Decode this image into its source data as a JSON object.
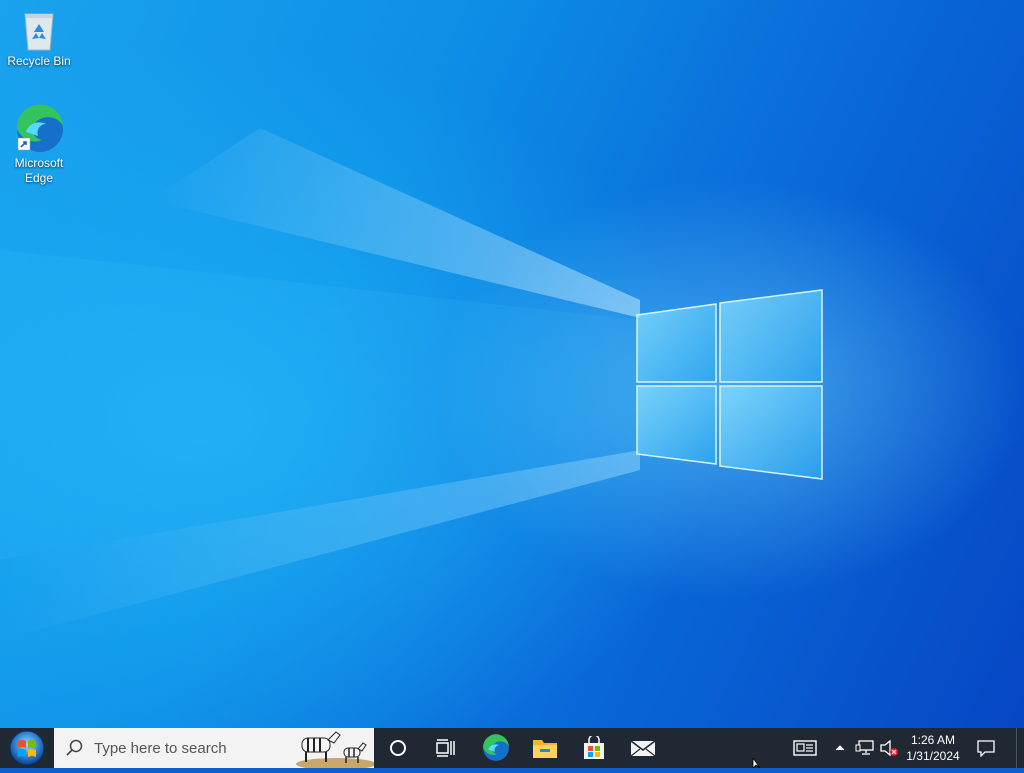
{
  "desktop": {
    "icons": [
      {
        "label": "Recycle Bin",
        "icon": "recycle-bin-icon"
      },
      {
        "label": "Microsoft\nEdge",
        "icon": "edge-icon"
      }
    ]
  },
  "taskbar": {
    "start_icon": "windows-orb-icon",
    "search": {
      "placeholder": "Type here to search"
    },
    "pinned": [
      {
        "name": "cortana",
        "icon": "circle-icon"
      },
      {
        "name": "task-view",
        "icon": "task-view-icon"
      },
      {
        "name": "edge",
        "icon": "edge-icon"
      },
      {
        "name": "file-explorer",
        "icon": "folder-icon"
      },
      {
        "name": "store",
        "icon": "store-bag-icon"
      },
      {
        "name": "mail",
        "icon": "mail-icon"
      }
    ],
    "tray": {
      "news_icon": "news-icon",
      "chevron_icon": "chevron-up-icon",
      "network_icon": "network-icon",
      "volume_icon": "volume-muted-icon",
      "time": "1:26 AM",
      "date": "1/31/2024",
      "notification_icon": "action-center-icon"
    }
  },
  "colors": {
    "taskbar_bg": "#1f2833",
    "search_bg": "#f3f3f3",
    "accent_blue": "#0a78d7"
  }
}
